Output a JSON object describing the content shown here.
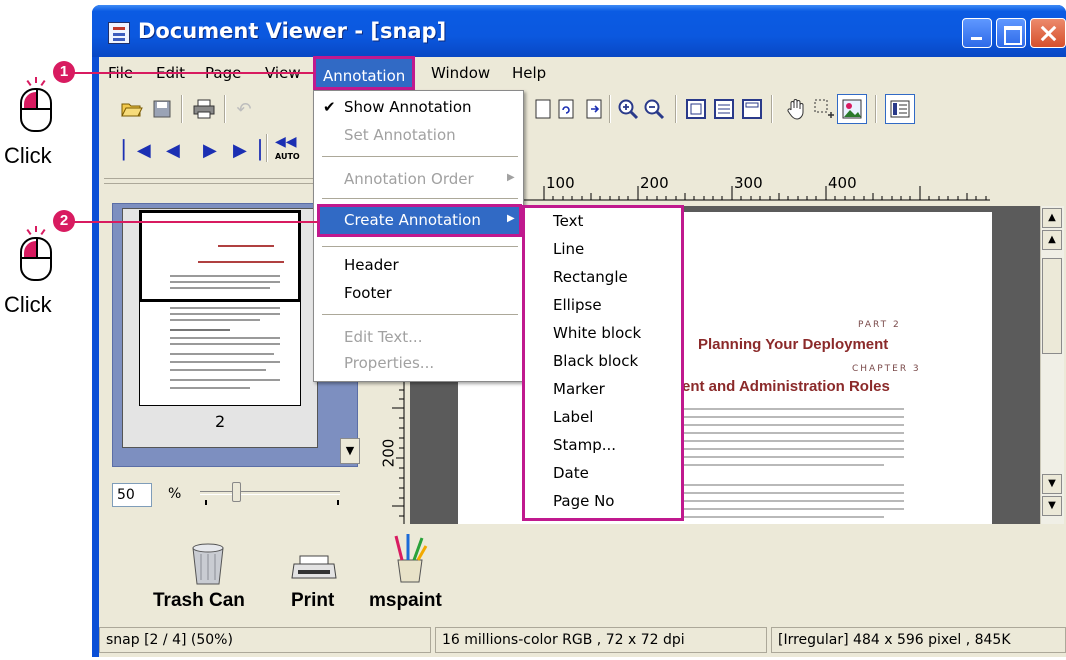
{
  "window": {
    "title": "Document Viewer - [snap]"
  },
  "menubar": {
    "items": [
      "File",
      "Edit",
      "Page",
      "View",
      "Annotation",
      "Window",
      "Help"
    ]
  },
  "annotation_menu": {
    "show_annotation": "Show Annotation",
    "set_annotation": "Set Annotation",
    "annotation_order": "Annotation Order",
    "create_annotation": "Create Annotation",
    "header": "Header",
    "footer": "Footer",
    "edit_text": "Edit Text...",
    "properties": "Properties..."
  },
  "create_submenu": {
    "items": [
      "Text",
      "Line",
      "Rectangle",
      "Ellipse",
      "White block",
      "Black block",
      "Marker",
      "Label",
      "Stamp...",
      "Date",
      "Page No"
    ]
  },
  "toolbar": {
    "auto_label": "AUTO"
  },
  "thumbnail": {
    "page_number": "2",
    "zoom_value": "50",
    "zoom_unit": "%"
  },
  "ruler": {
    "horizontal_ticks": [
      "100",
      "200",
      "300",
      "400"
    ],
    "vertical_tick": "200"
  },
  "document": {
    "part": "PART 2",
    "heading": "Planning Your Deployment",
    "chapter": "CHAPTER 3",
    "subheading": "ent and Administration Roles"
  },
  "desktop_icons": [
    "Trash Can",
    "Print",
    "mspaint"
  ],
  "statusbar": {
    "page_info": "snap [2 / 4] (50%)",
    "color_info": "16 millions-color RGB ,  72 x 72 dpi",
    "size_info": "[Irregular]  484 x 596 pixel , 845K"
  },
  "callouts": {
    "step1": "1",
    "step2": "2",
    "click_label": "Click"
  },
  "colors": {
    "highlight_magenta": "#c0198e",
    "menu_selection": "#316ac5",
    "title_blue": "#0b58df",
    "callout_pink": "#d81b60",
    "document_heading": "#8b2a2a"
  }
}
